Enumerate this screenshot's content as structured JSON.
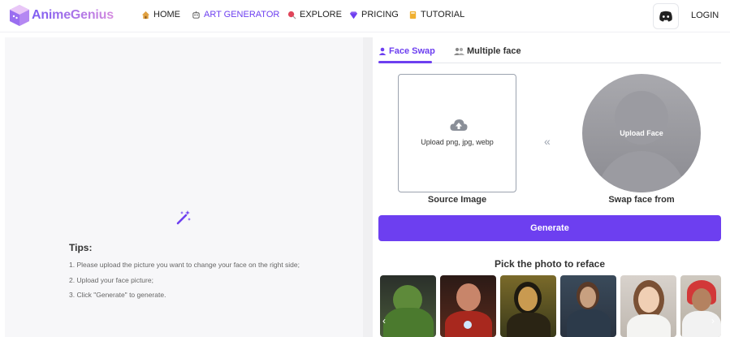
{
  "header": {
    "logo_text": "AnimeGenius",
    "nav": [
      {
        "label": "HOME",
        "icon": "house-icon"
      },
      {
        "label": "ART GENERATOR",
        "icon": "robot-icon",
        "active": true
      },
      {
        "label": "EXPLORE",
        "icon": "lollipop-icon"
      },
      {
        "label": "PRICING",
        "icon": "gem-icon"
      },
      {
        "label": "TUTORIAL",
        "icon": "book-icon"
      }
    ],
    "discord_icon": "discord-icon",
    "login_label": "LOGIN"
  },
  "left_panel": {
    "icon": "magic-wand-icon",
    "tips_title": "Tips:",
    "tips": [
      "1. Please upload the picture you want to change your face on the right side;",
      "2. Upload your face picture;",
      "3. Click \"Generate\" to generate."
    ]
  },
  "tabs": [
    {
      "label": "Face Swap",
      "icon": "user-icon",
      "active": true
    },
    {
      "label": "Multiple face",
      "icon": "users-icon",
      "active": false
    }
  ],
  "source": {
    "upload_text": "Upload png, jpg, webp",
    "label": "Source Image",
    "icon": "cloud-upload-icon"
  },
  "swap": {
    "chevron": "«",
    "upload_text": "Upload Face",
    "label": "Swap face from"
  },
  "generate_label": "Generate",
  "gallery": {
    "title": "Pick the photo to reface",
    "arrow_left": "‹",
    "arrow_right": "›",
    "photos": [
      "hulk",
      "iron-man",
      "mona-lisa",
      "knight",
      "woman",
      "arab-man"
    ]
  },
  "colors": {
    "accent": "#6d3ff0",
    "panel_bg": "#f7f7f9"
  }
}
